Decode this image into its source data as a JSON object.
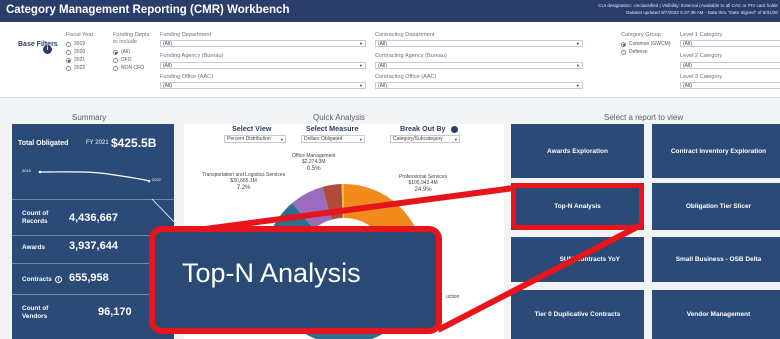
{
  "header": {
    "title": "Category Management Reporting (CMR) Workbench",
    "meta_line1": "CUI designation: Unclassified  |  Visibility: External (Available to all CAC or PIV card holde",
    "meta_line2": "Dataset updated 9/7/2022 5:27:39 AM - Data thru \"Date Signed\" of 8/31/20"
  },
  "filters": {
    "base_label": "Base Filters",
    "info": "i",
    "fiscal_year": {
      "label": "Fiscal Year",
      "options": [
        "2019",
        "2020",
        "2021",
        "2022"
      ],
      "selected": "2021"
    },
    "funding_depts": {
      "label": "Funding Depts to include",
      "options": [
        "(All)",
        "CFO",
        "NON CFO"
      ],
      "selected": "(All)"
    },
    "funding_department": {
      "label": "Funding Department",
      "value": "(All)"
    },
    "funding_agency": {
      "label": "Funding Agency (Bureau)",
      "value": "(All)"
    },
    "funding_office": {
      "label": "Funding Office (AAC)",
      "value": "(All)"
    },
    "contracting_department": {
      "label": "Contracting Department",
      "value": "(All)"
    },
    "contracting_agency": {
      "label": "Contracting Agency (Bureau)",
      "value": "(All)"
    },
    "contracting_office": {
      "label": "Contracting Office (AAC)",
      "value": "(All)"
    },
    "category_group": {
      "label": "Category Group",
      "options": [
        "Common (GWCM)",
        "Defense"
      ],
      "selected": "Common (GWCM)"
    },
    "level1": {
      "label": "Level 1 Category",
      "value": "(All)"
    },
    "level2": {
      "label": "Level 2 Category",
      "value": "(All)"
    },
    "level3": {
      "label": "Level 3 Category",
      "value": "(All)"
    }
  },
  "sections": {
    "summary": "Summary",
    "quick_analysis": "Quick Analysis",
    "select_report": "Select a report to view"
  },
  "summary": {
    "total_label": "Total Obligated",
    "fy_label": "FY 2021",
    "total_value": "$425.5B",
    "spark_start": "2019",
    "spark_end": "2022",
    "stats": [
      {
        "label_1": "Count of",
        "label_2": "Records",
        "value": "4,436,667"
      },
      {
        "label_1": "Awards",
        "label_2": "",
        "value": "3,937,644"
      },
      {
        "label_1": "Contracts",
        "label_2": "",
        "value": "655,958"
      },
      {
        "label_1": "Count of",
        "label_2": "Vendors",
        "value": "96,170"
      }
    ]
  },
  "quick_analysis": {
    "select_view": {
      "label": "Select View",
      "value": "Percent Distribution"
    },
    "select_measure": {
      "label": "Select Measure",
      "value": "Dollars Obligated"
    },
    "break_out_by": {
      "label": "Break Out By",
      "value": "Category/Subcategory"
    },
    "chart_data": {
      "type": "pie",
      "segments": [
        {
          "name": "Office Management",
          "value_text": "$2,274.3M",
          "pct": 0.5,
          "pct_text": "0.5%"
        },
        {
          "name": "Transportation and Logistics Services",
          "value_text": "$30,665.1M",
          "pct": 7.2,
          "pct_text": "7.2%"
        },
        {
          "name": "Professional Services",
          "value_text": "$105,943.4M",
          "pct": 24.9,
          "pct_text": "24.9%"
        }
      ],
      "partial_labels": [
        "2M",
        "uction"
      ]
    }
  },
  "reports": [
    "Awards Exploration",
    "Contract Inventory Exploration",
    "Top-N Analysis",
    "Obligation Tier Slicer",
    "SUM Contracts YoY",
    "Small Business - OSB Delta",
    "Tier 0 Duplicative Contracts",
    "Vendor Management"
  ],
  "callout": {
    "text": "Top-N Analysis",
    "highlight_color": "#e8141b"
  },
  "colors": {
    "header": "#2b3d6b",
    "panel": "#2b4a78",
    "accent_orange": "#f28a1c",
    "callout_red": "#e8141b"
  }
}
